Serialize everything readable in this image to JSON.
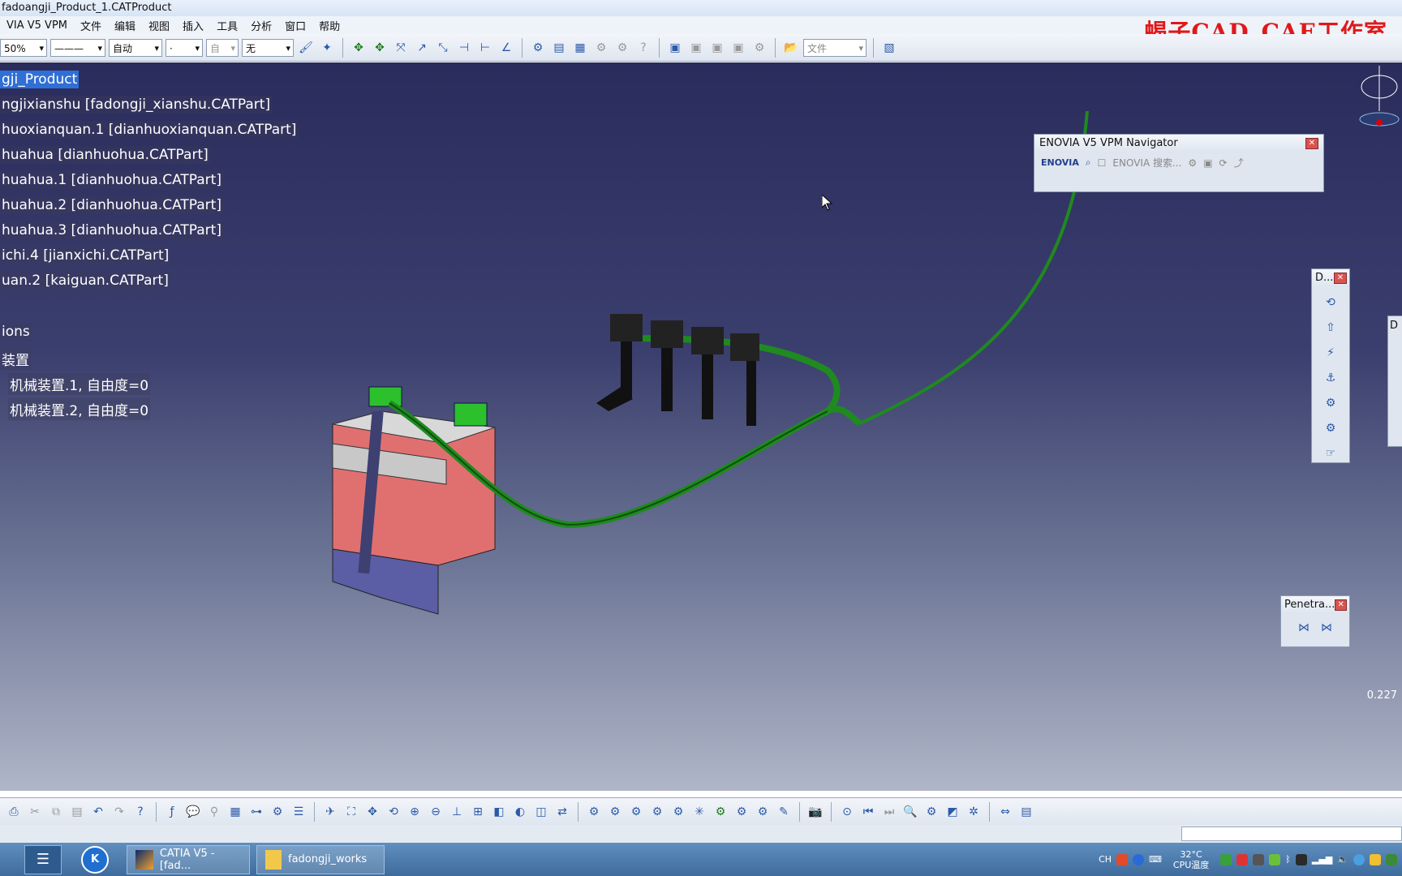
{
  "window": {
    "title": "fadoangji_Product_1.CATProduct"
  },
  "menu": {
    "items": [
      "VIA V5 VPM",
      "文件",
      "编辑",
      "视图",
      "插入",
      "工具",
      "分析",
      "窗口",
      "帮助"
    ]
  },
  "watermark": "蝎子CAD_CAE工作室",
  "toolbar": {
    "zoom_combo": "50%",
    "line_combo": "———",
    "auto_combo": "自动",
    "dot_combo": "·",
    "layer_combo": "自",
    "none_combo": "无",
    "file_combo": "文件"
  },
  "tree": {
    "nodes": [
      "gji_Product",
      "ngjixianshu [fadongji_xianshu.CATPart]",
      "huoxianquan.1 [dianhuoxianquan.CATPart]",
      "huahua [dianhuohua.CATPart]",
      "huahua.1 [dianhuohua.CATPart]",
      "huahua.2 [dianhuohua.CATPart]",
      "huahua.3 [dianhuohua.CATPart]",
      "ichi.4 [jianxichi.CATPart]",
      "uan.2 [kaiguan.CATPart]",
      "ions",
      "装置",
      "机械装置.1, 自由度=0",
      "机械装置.2, 自由度=0"
    ]
  },
  "enovia_panel": {
    "title": "ENOVIA V5 VPM Navigator",
    "logo": "ENOVIA",
    "search_label": "ENOVIA 搜索..."
  },
  "d_panel": {
    "title": "D..."
  },
  "d_panel2": {
    "title": "D"
  },
  "penetra_panel": {
    "title": "Penetra..."
  },
  "viewport": {
    "zoom_value": "0.227"
  },
  "taskbar": {
    "catia_task": "CATIA V5 - [fad...",
    "folder_task": "fadongji_works",
    "lang": "CH",
    "temperature": "32°C",
    "cpu_label": "CPU温度"
  },
  "colors": {
    "viewport_top": "#2a2c5c",
    "harness_green": "#1f8a1f",
    "battery_red": "#e07070"
  }
}
